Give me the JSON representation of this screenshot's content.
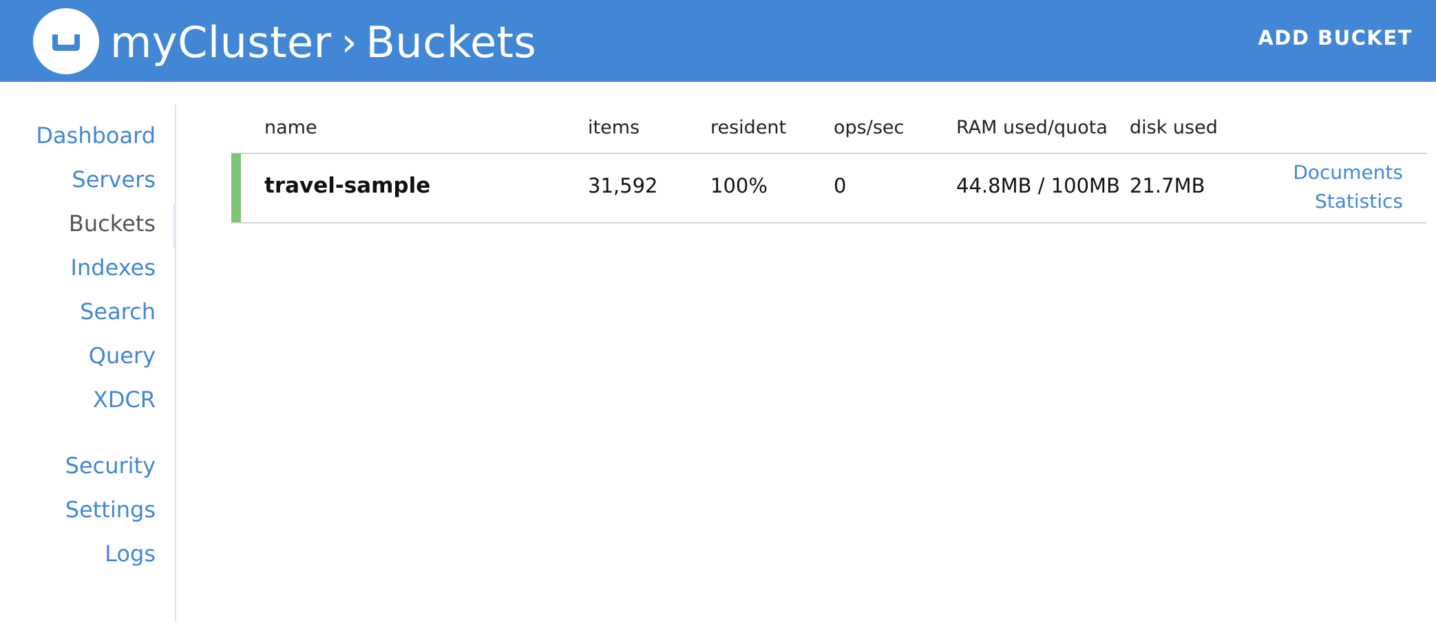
{
  "header": {
    "cluster_name": "myCluster",
    "separator": "›",
    "section": "Buckets",
    "add_bucket_label": "ADD BUCKET",
    "bg_color": "#4287d6"
  },
  "sidebar": {
    "active": "Buckets",
    "items": [
      {
        "label": "Dashboard"
      },
      {
        "label": "Servers"
      },
      {
        "label": "Buckets"
      },
      {
        "label": "Indexes"
      },
      {
        "label": "Search"
      },
      {
        "label": "Query"
      },
      {
        "label": "XDCR"
      },
      {
        "label": "Security"
      },
      {
        "label": "Settings"
      },
      {
        "label": "Logs"
      }
    ]
  },
  "table": {
    "columns": [
      "name",
      "items",
      "resident",
      "ops/sec",
      "RAM used/quota",
      "disk used"
    ],
    "rows": [
      {
        "name": "travel-sample",
        "items": "31,592",
        "resident": "100%",
        "ops_sec": "0",
        "ram": "44.8MB / 100MB",
        "disk": "21.7MB",
        "status_color": "#7cc576",
        "links": [
          "Documents",
          "Statistics"
        ]
      }
    ]
  }
}
